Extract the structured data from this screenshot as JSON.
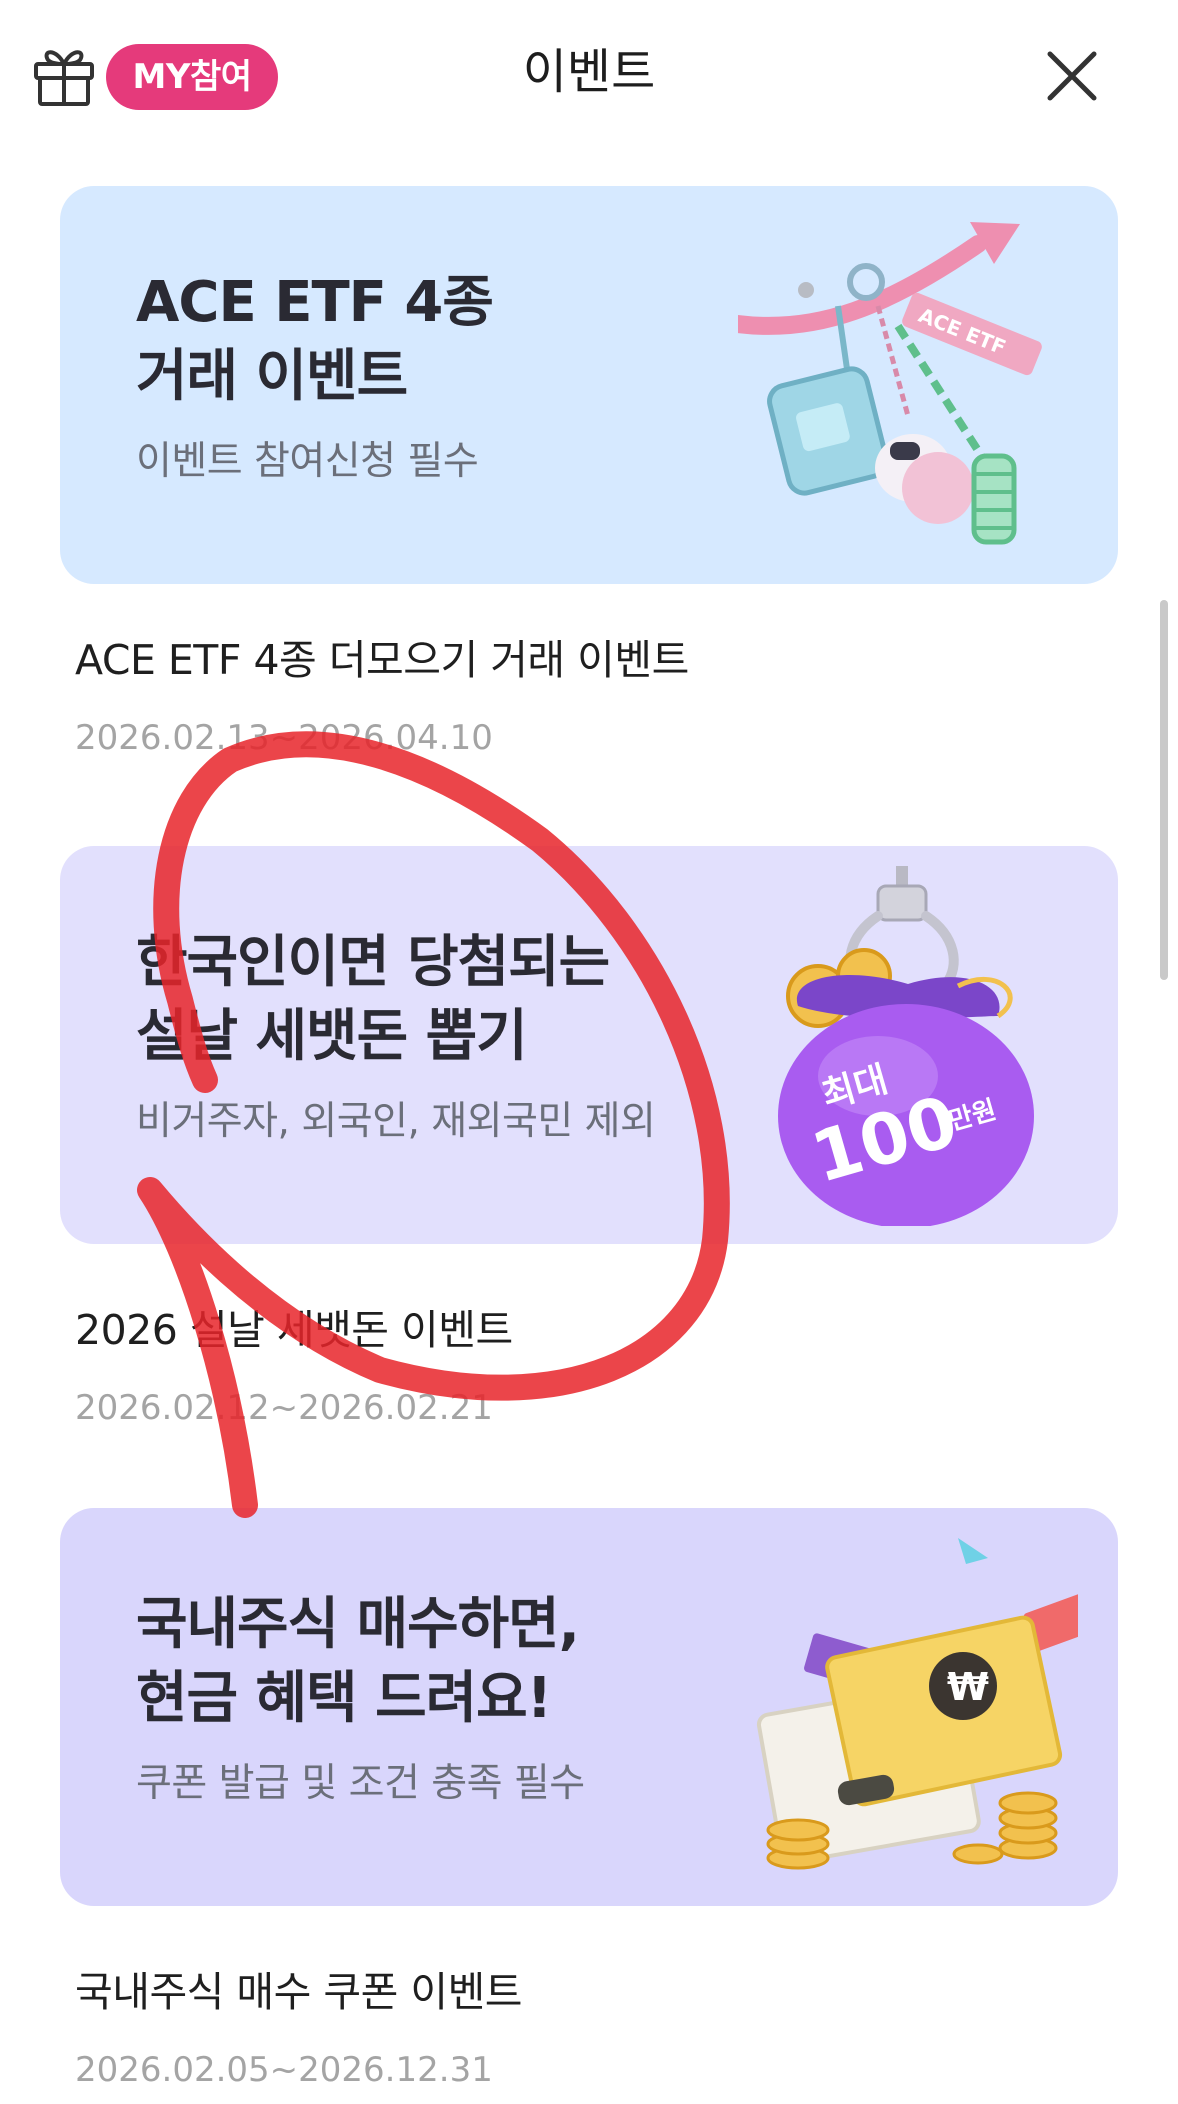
{
  "header": {
    "my_badge": "MY참여",
    "title": "이벤트"
  },
  "events": [
    {
      "banner_title_line1": "ACE ETF 4종",
      "banner_title_line2": "거래 이벤트",
      "banner_sub": "이벤트 참여신청 필수",
      "banner_tag": "ACE ETF",
      "name": "ACE ETF 4종 더모으기 거래 이벤트",
      "date": "2026.02.13~2026.04.10",
      "bg": "#d6e9ff"
    },
    {
      "banner_title_line1": "한국인이면 당첨되는",
      "banner_title_line2": "설날 세뱃돈 뽑기",
      "banner_sub": "비거주자, 외국인, 재외국민 제외",
      "bag_line1": "최대",
      "bag_line2": "100",
      "bag_unit": "만원",
      "name": "2026 설날 세뱃돈 이벤트",
      "date": "2026.02.12~2026.02.21",
      "bg": "#e2e0fd"
    },
    {
      "banner_title_line1": "국내주식 매수하면,",
      "banner_title_line2": "현금 혜택 드려요!",
      "banner_sub": "쿠폰 발급 및 조건 충족 필수",
      "name": "국내주식 매수 쿠폰 이벤트",
      "date": "2026.02.05~2026.12.31",
      "bg": "#d9d6fc"
    }
  ],
  "colors": {
    "badge": "#e53a7b",
    "annotation": "#e8252a"
  }
}
